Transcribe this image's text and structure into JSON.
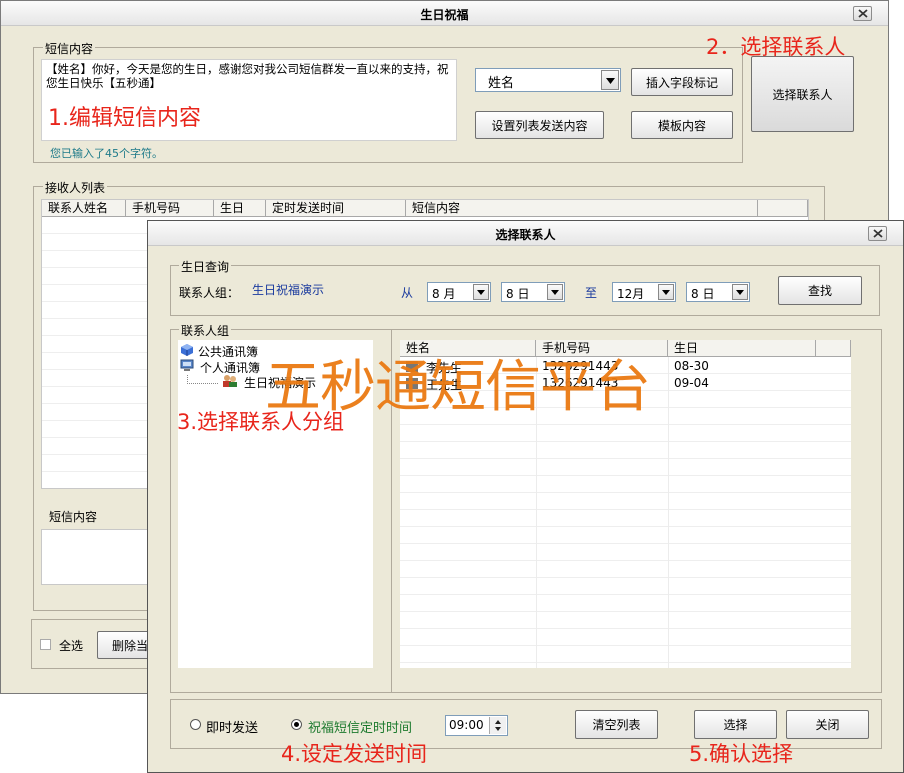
{
  "main_window": {
    "title": "生日祝福",
    "sms_group_label": "短信内容",
    "sms_text": "【姓名】你好，今天是您的生日，感谢您对我公司短信群发一直以来的支持，祝您生日快乐【五秒通】",
    "char_count": "您已输入了45个字符。",
    "field_select": "姓名",
    "insert_field_button": "插入字段标记",
    "set_list_button": "设置列表发送内容",
    "template_button": "模板内容",
    "select_contacts_button": "选择联系人",
    "recipients_group_label": "接收人列表",
    "recipients_columns": [
      "联系人姓名",
      "手机号码",
      "生日",
      "定时发送时间",
      "短信内容"
    ],
    "bottom_sms_label": "短信内容",
    "select_all_label": "全选",
    "delete_button_partial": "删除当"
  },
  "dialog": {
    "title": "选择联系人",
    "birthday_query_label": "生日查询",
    "contact_group_field_label": "联系人组：",
    "contact_group_value": "生日祝福演示",
    "from_label": "从",
    "from_month": "8 月",
    "from_day": "8 日",
    "to_label": "至",
    "to_month": "12月",
    "to_day": "8 日",
    "search_button": "查找",
    "contact_group_label": "联系人组",
    "tree": {
      "public_book": "公共通讯簿",
      "personal_book": "个人通讯簿",
      "child_group": "生日祝福演示"
    },
    "columns": [
      "姓名",
      "手机号码",
      "生日"
    ],
    "rows": [
      {
        "name": "李先生",
        "phone": "1326291443",
        "birthday": "08-30"
      },
      {
        "name": "王先生",
        "phone": "1326291443",
        "birthday": "09-04"
      }
    ],
    "immediate_send_label": "即时发送",
    "scheduled_send_label": "祝福短信定时时间",
    "time_value": "09:00",
    "clear_list_button": "清空列表",
    "select_button": "选择",
    "close_button": "关闭"
  },
  "annotations": {
    "edit_sms": "1.编辑短信内容",
    "select_contacts": "2．选择联系人",
    "select_group": "3.选择联系人分组",
    "set_time": "4.设定发送时间",
    "confirm": "5.确认选择",
    "watermark": "五秒通短信平台"
  }
}
